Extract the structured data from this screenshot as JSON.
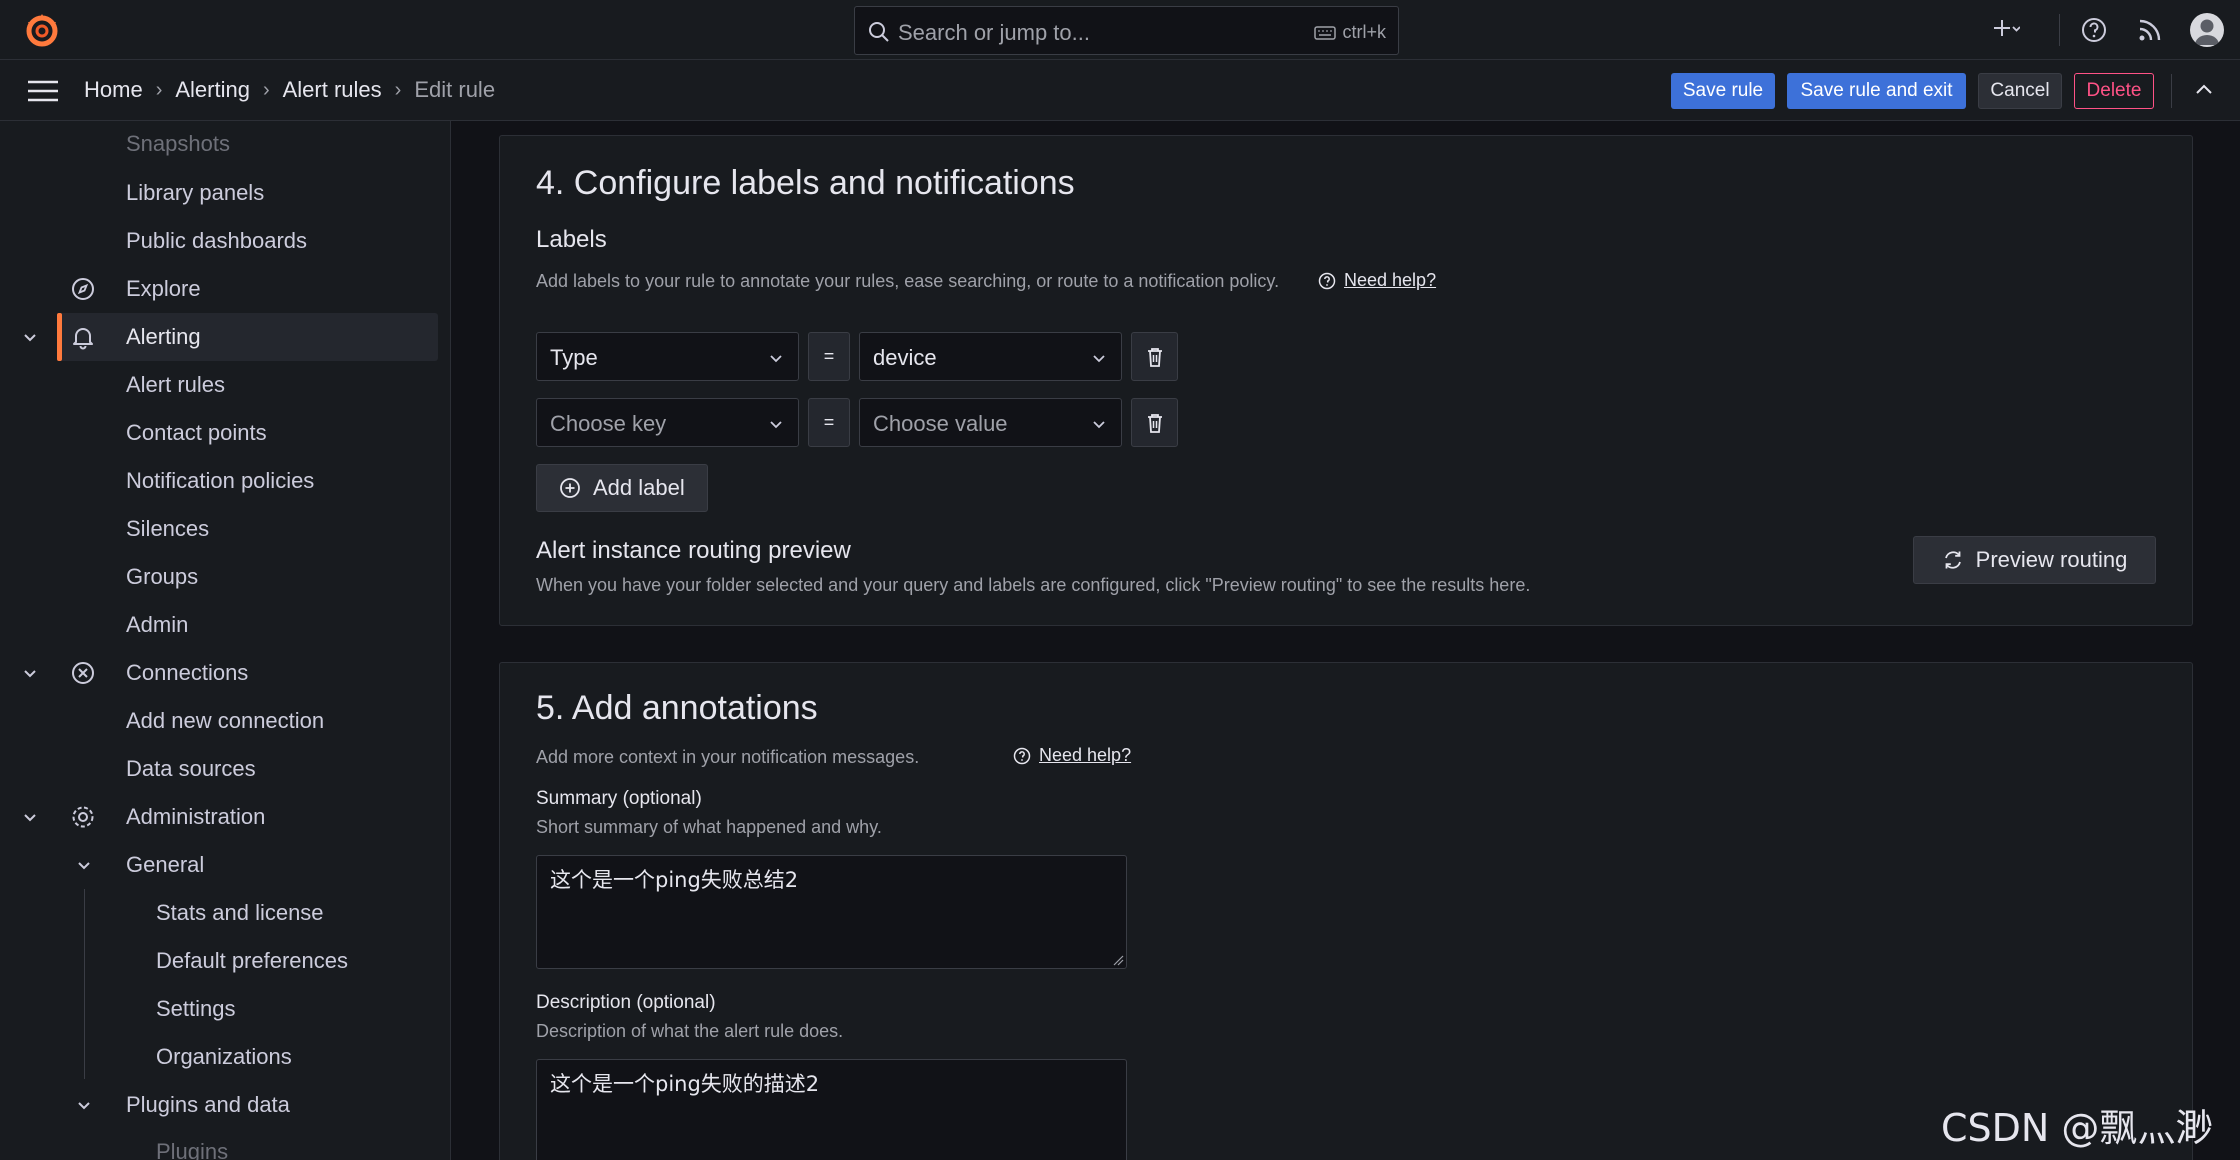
{
  "search": {
    "placeholder": "Search or jump to...",
    "shortcut": "ctrl+k"
  },
  "breadcrumb": [
    "Home",
    "Alerting",
    "Alert rules",
    "Edit rule"
  ],
  "actions": {
    "save": "Save rule",
    "save_exit": "Save rule and exit",
    "cancel": "Cancel",
    "delete": "Delete"
  },
  "sidebar": {
    "snapshots": "Snapshots",
    "library_panels": "Library panels",
    "public_dashboards": "Public dashboards",
    "explore": "Explore",
    "alerting": "Alerting",
    "alert_rules": "Alert rules",
    "contact_points": "Contact points",
    "notification_policies": "Notification policies",
    "silences": "Silences",
    "groups": "Groups",
    "admin": "Admin",
    "connections": "Connections",
    "add_new_connection": "Add new connection",
    "data_sources": "Data sources",
    "administration": "Administration",
    "general": "General",
    "stats_and_license": "Stats and license",
    "default_preferences": "Default preferences",
    "settings": "Settings",
    "organizations": "Organizations",
    "plugins_and_data": "Plugins and data",
    "plugins": "Plugins"
  },
  "section4": {
    "title": "4. Configure labels and notifications",
    "labels_heading": "Labels",
    "labels_desc": "Add labels to your rule to annotate your rules, ease searching, or route to a notification policy.",
    "help": "Need help?",
    "rows": [
      {
        "key": "Type",
        "op": "=",
        "value": "device"
      },
      {
        "key": "Choose key",
        "op": "=",
        "value": "Choose value"
      }
    ],
    "add_label": "Add label",
    "routing_heading": "Alert instance routing preview",
    "routing_desc": "When you have your folder selected and your query and labels are configured, click \"Preview routing\" to see the results here.",
    "preview_routing": "Preview routing"
  },
  "section5": {
    "title": "5. Add annotations",
    "desc": "Add more context in your notification messages.",
    "help": "Need help?",
    "summary_label": "Summary (optional)",
    "summary_desc": "Short summary of what happened and why.",
    "summary_value": "这个是一个ping失败总结2",
    "description_label": "Description (optional)",
    "description_desc": "Description of what the alert rule does.",
    "description_value": "这个是一个ping失败的描述2"
  },
  "watermark": "CSDN @飘灬渺",
  "colors": {
    "primary": "#3d71d9",
    "danger": "#ff5286",
    "accent": "#ff7a3d"
  }
}
